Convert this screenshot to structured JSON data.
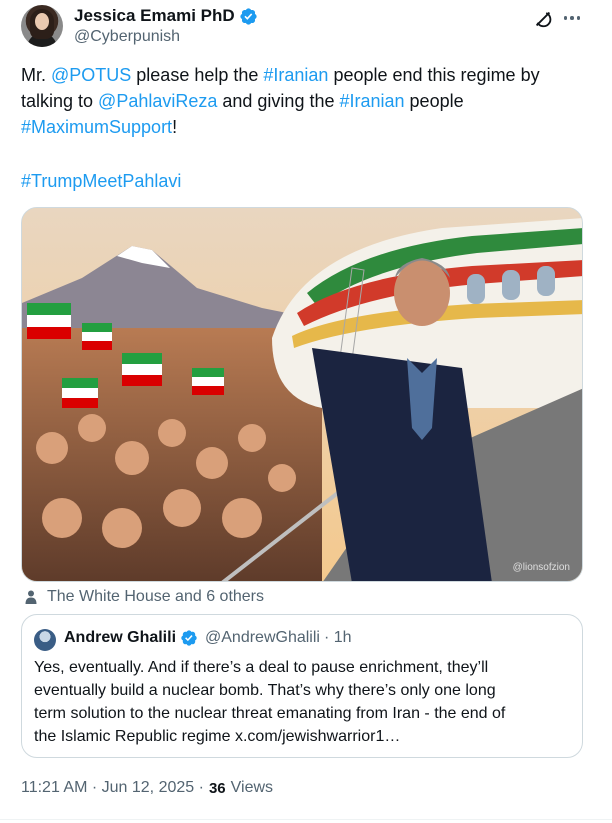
{
  "author": {
    "name": "Jessica Emami PhD",
    "handle": "@Cyberpunish"
  },
  "tweet": {
    "lines": [
      [
        {
          "text": "Mr. ",
          "type": "text"
        },
        {
          "text": "@POTUS",
          "type": "link"
        },
        {
          "text": " please help the ",
          "type": "text"
        },
        {
          "text": "#Iranian",
          "type": "link"
        },
        {
          "text": " people end this regime by",
          "type": "text"
        }
      ],
      [
        {
          "text": "talking to ",
          "type": "text"
        },
        {
          "text": "@PahlaviReza",
          "type": "link"
        },
        {
          "text": " and giving the ",
          "type": "text"
        },
        {
          "text": "#Iranian",
          "type": "link"
        },
        {
          "text": " people",
          "type": "text"
        }
      ],
      [
        {
          "text": "#MaximumSupport",
          "type": "link"
        },
        {
          "text": "!",
          "type": "text"
        }
      ]
    ],
    "hashtag": "#TrumpMeetPahlavi"
  },
  "media": {
    "watermark": "@lionsofzion"
  },
  "tagged": "The White House and 6 others",
  "quote": {
    "name": "Andrew Ghalili",
    "handle": "@AndrewGhalili",
    "time": "· 1h",
    "lines": [
      "Yes, eventually. And if there’s a deal to pause enrichment, they’ll",
      "eventually build a nuclear bomb. That’s why there’s only one long",
      "term solution to the nuclear threat emanating from Iran - the end of",
      "the Islamic Republic regime x.com/jewishwarrior1…"
    ]
  },
  "meta": {
    "timestamp": "11:21 AM · Jun 12, 2025 ·",
    "views_count": "36",
    "views_label": "Views"
  },
  "colors": {
    "accent": "#1d9bf0",
    "muted": "#536471",
    "text": "#0f1419"
  }
}
